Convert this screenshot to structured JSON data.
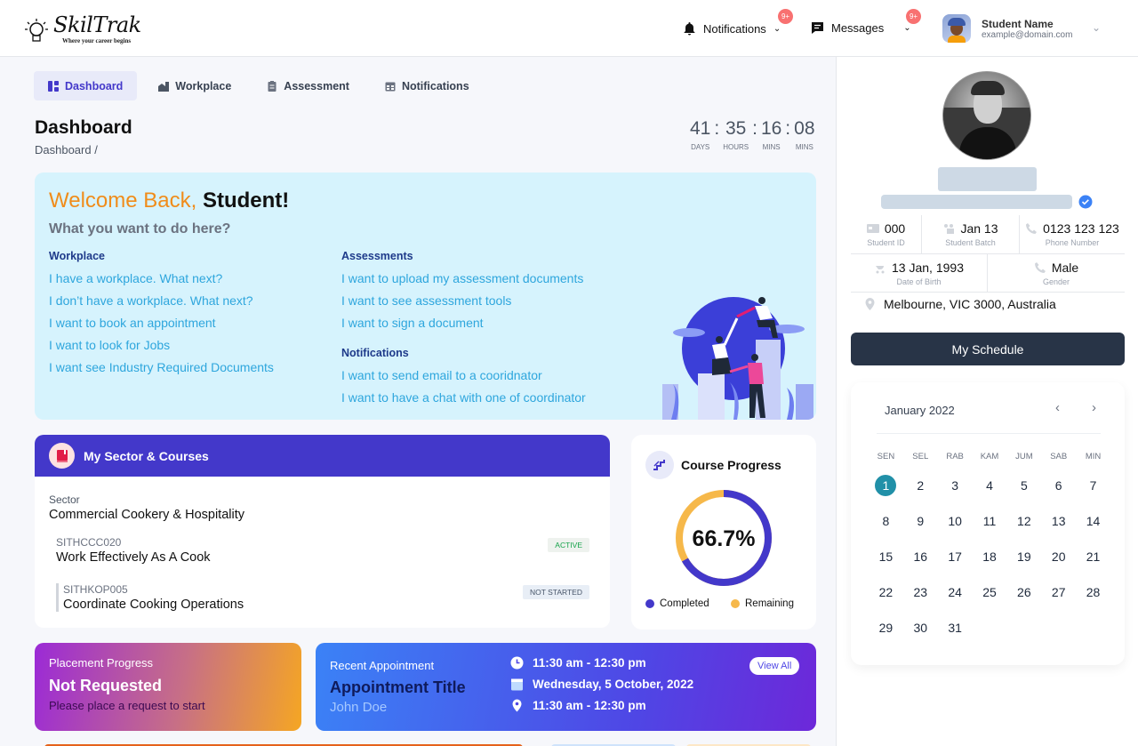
{
  "header": {
    "logo": {
      "brand": "SkilTrak",
      "tagline": "Where your career begins"
    },
    "notifications": {
      "label": "Notifications",
      "badge": "9+"
    },
    "messages": {
      "label": "Messages",
      "badge": "9+"
    },
    "user": {
      "name": "Student Name",
      "email": "example@domain.com"
    }
  },
  "tabs": [
    {
      "label": "Dashboard",
      "icon": "dashboard-icon",
      "active": true
    },
    {
      "label": "Workplace",
      "icon": "building-icon",
      "active": false
    },
    {
      "label": "Assessment",
      "icon": "clipboard-icon",
      "active": false
    },
    {
      "label": "Notifications",
      "icon": "calendar-icon",
      "active": false
    }
  ],
  "page": {
    "title": "Dashboard",
    "breadcrumb": "Dashboard /"
  },
  "countdown": [
    {
      "value": "41",
      "label": "DAYS"
    },
    {
      "value": "35",
      "label": "HOURS"
    },
    {
      "value": "16",
      "label": "MINS"
    },
    {
      "value": "08",
      "label": "MINS"
    }
  ],
  "welcome": {
    "greeting": "Welcome Back,",
    "name": "Student!",
    "subtitle": "What you want to do here?",
    "workplace": {
      "heading": "Workplace",
      "links": [
        "I have a workplace. What next?",
        "I don’t have a workplace. What next?",
        "I want to book an appointment",
        "I want to look for Jobs",
        "I want see Industry Required Documents"
      ]
    },
    "assessments": {
      "heading": "Assessments",
      "links": [
        "I want to upload my assessment documents",
        "I want to see assessment tools",
        "I want to sign a document"
      ]
    },
    "notifications": {
      "heading": "Notifications",
      "links": [
        "I want to send email to a cooridnator",
        "I want to have a chat with one of coordinator"
      ]
    }
  },
  "sector_card": {
    "title": "My Sector & Courses",
    "sector_label": "Sector",
    "sector_value": "Commercial Cookery & Hospitality",
    "courses": [
      {
        "code": "SITHCCC020",
        "name": "Work Effectively As A Cook",
        "status": "ACTIVE"
      },
      {
        "code": "SITHKOP005",
        "name": "Coordinate Cooking Operations",
        "status": "NOT STARTED"
      }
    ]
  },
  "course_progress": {
    "title": "Course Progress",
    "percent_label": "66.7%",
    "completed_fraction": 0.667,
    "legend": {
      "completed": "Completed",
      "remaining": "Remaining"
    },
    "colors": {
      "completed": "#4338ca",
      "remaining": "#f6b84a"
    }
  },
  "placement": {
    "label": "Placement Progress",
    "status": "Not Requested",
    "hint": "Please place a request to start"
  },
  "appointment": {
    "label": "Recent Appointment",
    "title": "Appointment Title",
    "person": "John Doe",
    "time": "11:30 am - 12:30 pm",
    "date": "Wednesday, 5 October, 2022",
    "location": "11:30 am - 12:30 pm",
    "view_all": "View All"
  },
  "profile": {
    "student_id": {
      "value": "000",
      "label": "Student ID"
    },
    "batch": {
      "value": "Jan 13",
      "label": "Student Batch"
    },
    "phone": {
      "value": "0123 123 123",
      "label": "Phone Number"
    },
    "dob": {
      "value": "13 Jan, 1993",
      "label": "Date of Birth"
    },
    "gender": {
      "value": "Male",
      "label": "Gender"
    },
    "address": "Melbourne, VIC 3000, Australia",
    "schedule_button": "My Schedule"
  },
  "calendar": {
    "month": "January 2022",
    "weekdays": [
      "SEN",
      "SEL",
      "RAB",
      "KAM",
      "JUM",
      "SAB",
      "MIN"
    ],
    "days": 31,
    "selected": 1
  }
}
